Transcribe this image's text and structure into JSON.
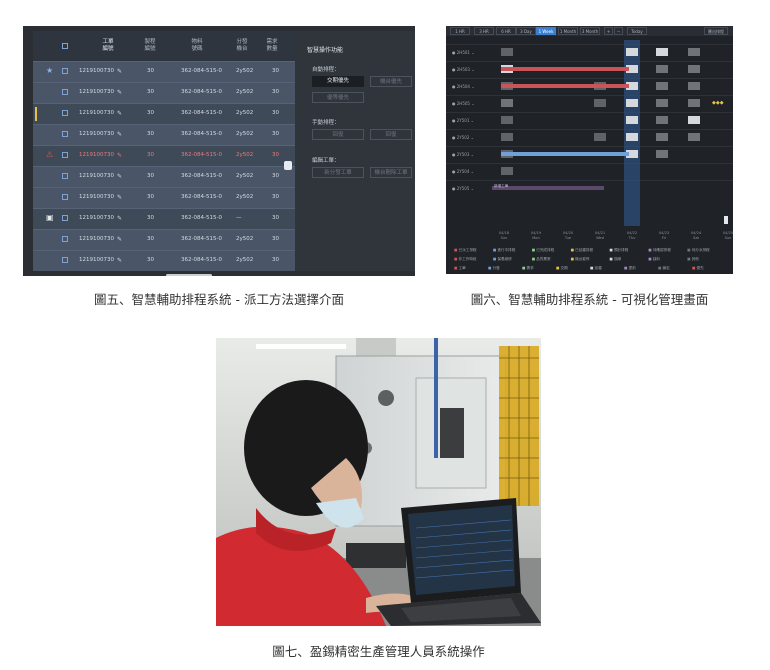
{
  "fig5": {
    "caption": "圖五、智慧輔助排程系統 - 派工方法選擇介面",
    "headers": [
      "工單\n編號",
      "製程\n編號",
      "物料\n號碼",
      "分發\n機台",
      "需求\n數量"
    ],
    "rows": [
      {
        "wo": "1219100730",
        "op": "30",
        "mat": "362-084-515-0",
        "mc": "2y502",
        "qty": "30",
        "mark": "star",
        "tone": "light",
        "bar": ""
      },
      {
        "wo": "1219100730",
        "op": "30",
        "mat": "362-084-515-0",
        "mc": "2y502",
        "qty": "30",
        "mark": "",
        "tone": "light",
        "bar": ""
      },
      {
        "wo": "1219100730",
        "op": "30",
        "mat": "362-084-515-0",
        "mc": "2y502",
        "qty": "30",
        "mark": "",
        "tone": "dark",
        "bar": "#e6c04c"
      },
      {
        "wo": "1219100730",
        "op": "30",
        "mat": "362-084-515-0",
        "mc": "2y502",
        "qty": "30",
        "mark": "",
        "tone": "light",
        "bar": ""
      },
      {
        "wo": "1219100730",
        "op": "30",
        "mat": "362-084-515-0",
        "mc": "2y502",
        "qty": "30",
        "mark": "warn",
        "tone": "dark",
        "bar": "",
        "red": true
      },
      {
        "wo": "1219100730",
        "op": "30",
        "mat": "362-084-515-0",
        "mc": "2y502",
        "qty": "30",
        "mark": "",
        "tone": "light",
        "bar": ""
      },
      {
        "wo": "1219100730",
        "op": "30",
        "mat": "362-084-515-0",
        "mc": "2y502",
        "qty": "30",
        "mark": "",
        "tone": "light",
        "bar": ""
      },
      {
        "wo": "1219100730",
        "op": "30",
        "mat": "362-084-515-0",
        "mc": "—",
        "qty": "30",
        "mark": "lock",
        "tone": "dark",
        "bar": ""
      },
      {
        "wo": "1219100730",
        "op": "30",
        "mat": "362-084-515-0",
        "mc": "2y502",
        "qty": "30",
        "mark": "",
        "tone": "light",
        "bar": ""
      },
      {
        "wo": "1219100730",
        "op": "30",
        "mat": "362-084-515-0",
        "mc": "2y502",
        "qty": "30",
        "mark": "",
        "tone": "light",
        "bar": ""
      }
    ],
    "panel": {
      "title": "智慧操作功能",
      "auto_label": "自動排程：",
      "auto_btn1": "交期優先",
      "auto_btn2": "機台優先",
      "auto_btn3": "優等優先",
      "manual_label": "手動排程：",
      "manual_btn1": "回復",
      "manual_btn2": "回復",
      "edit_label": "編輯工單：",
      "edit_btn1": "新分發工單",
      "edit_btn2": "機台刪除工單"
    }
  },
  "fig6": {
    "caption": "圖六、智慧輔助排程系統 - 可視化管理畫面",
    "tabs": [
      "1 HR",
      "3 HR",
      "6 HR",
      "3 Day",
      "1 Week",
      "1 Month",
      "3 Month"
    ],
    "active_tab": "1 Week",
    "today_btn": "Today",
    "export_btn": "匯出排程",
    "rows": [
      "2H501",
      "2H503",
      "2H504",
      "2H505",
      "2Y501",
      "2Y502",
      "2Y503",
      "2Y504",
      "2Y505"
    ],
    "ticks": [
      "04/18\nSun",
      "04/19\nMon",
      "04/20\nTue",
      "04/21\nWed",
      "04/22\nThu",
      "04/23\nFri",
      "04/24\nSat",
      "04/25\nSun"
    ],
    "bar_label": "新增工單",
    "legend_row1": [
      "已派工排程",
      "進行中排程",
      "已完成排程",
      "已延遲排程",
      "預計排程",
      "待確認排程",
      "待分派排程"
    ],
    "legend_row2": [
      "非工作時段",
      "保養維修",
      "品質異常",
      "機台暫停",
      "換線",
      "缺料",
      "其他"
    ],
    "legend_row3": [
      "工單",
      "分發",
      "需求",
      "交期",
      "延遲",
      "提前",
      "鎖定",
      "優先"
    ]
  },
  "fig7": {
    "caption": "圖七、盈錫精密生產管理人員系統操作"
  }
}
